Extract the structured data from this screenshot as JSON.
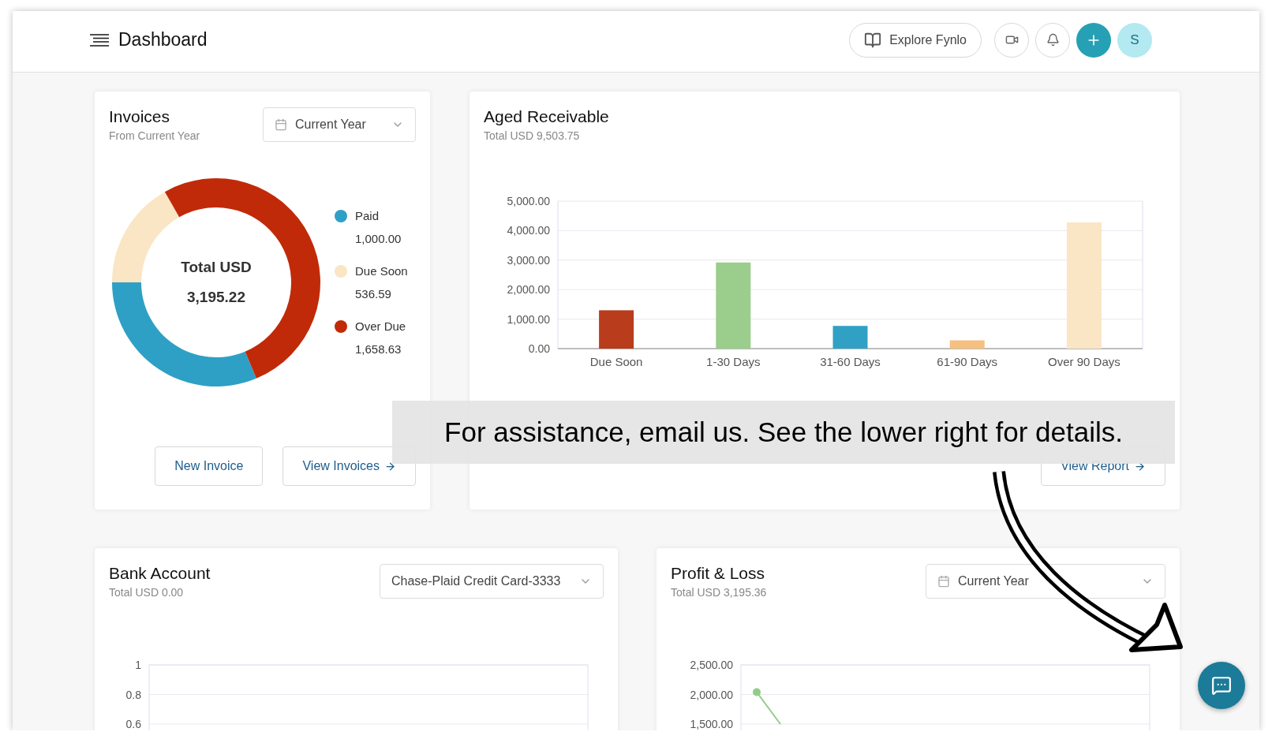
{
  "header": {
    "title": "Dashboard",
    "explore_button": "Explore Fynlo",
    "avatar": "S"
  },
  "invoices": {
    "title": "Invoices",
    "subtitle": "From Current Year",
    "dropdown": {
      "calendar_icon": true,
      "value": "Current Year"
    },
    "chart_data": {
      "type": "donut",
      "categories": [
        "Paid",
        "Due Soon",
        "Over Due"
      ],
      "values": [
        31.3,
        16.79,
        51.91
      ]
    },
    "center_label": "Total USD",
    "center_value": "3,195.22",
    "legend": [
      {
        "value": "1,000.00",
        "color": "#2fa0c5"
      },
      {
        "value": "536.59",
        "color": "#fae5c4"
      },
      {
        "value": "1,658.63",
        "color": "#c12a08"
      }
    ],
    "buttons": [
      {
        "label": "New Invoice",
        "arrow": false
      },
      {
        "label": "View Invoices",
        "arrow": true
      }
    ]
  },
  "aged_receivable": {
    "title": "Aged Receivable",
    "subtitle": "Total USD 9,503.75",
    "chart_data": {
      "type": "bar",
      "grid": true,
      "categories": [
        "Due Soon",
        "1-30 Days",
        "31-60 Days",
        "61-90 Days",
        "Over 90 Days"
      ],
      "values": [
        1300,
        2920,
        770,
        280,
        4280
      ],
      "colors": [
        "#b93c1c",
        "#9bcd8c",
        "#30a1c4",
        "#f5c07f",
        "#fae5c4"
      ],
      "ylim": [
        0,
        5000
      ],
      "yticks": [
        {
          "value": 0,
          "label": "0.00"
        },
        {
          "value": 1000,
          "label": "1,000.00"
        },
        {
          "value": 2000,
          "label": "2,000.00"
        },
        {
          "value": 3000,
          "label": "3,000.00"
        },
        {
          "value": 4000,
          "label": "4,000.00"
        },
        {
          "value": 5000,
          "label": "5,000.00"
        }
      ]
    },
    "button": {
      "label": "View Report",
      "arrow": true
    }
  },
  "bank_account": {
    "title": "Bank Account",
    "subtitle": "Total USD 0.00",
    "dropdown": {
      "calendar_icon": false,
      "value": "Chase-Plaid Credit Card-3333"
    },
    "axis_labels": [
      "1",
      "0.8",
      "0.6"
    ]
  },
  "profit_loss": {
    "title": "Profit & Loss",
    "subtitle": "Total USD 3,195.36",
    "dropdown": {
      "calendar_icon": true,
      "value": "Current Year"
    },
    "axis_labels": [
      "2,500.00",
      "2,000.00",
      "1,500.00"
    ]
  },
  "banner": {
    "text": "For assistance, email us. See the lower right for details."
  }
}
